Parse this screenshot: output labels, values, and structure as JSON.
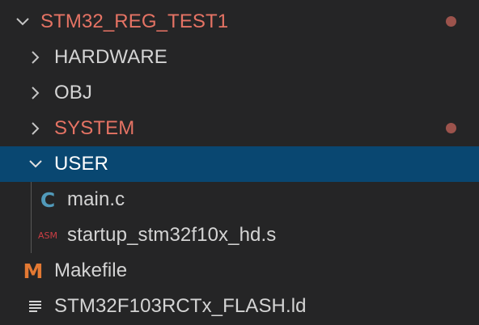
{
  "explorer": {
    "root": {
      "name": "STM32_REG_TEST1",
      "expanded": true,
      "modified": true
    },
    "items": [
      {
        "label": "HARDWARE",
        "type": "folder",
        "expanded": false,
        "modified": false
      },
      {
        "label": "OBJ",
        "type": "folder",
        "expanded": false,
        "modified": false
      },
      {
        "label": "SYSTEM",
        "type": "folder",
        "expanded": false,
        "modified": true
      },
      {
        "label": "USER",
        "type": "folder",
        "expanded": true,
        "selected": true,
        "modified": false
      },
      {
        "label": "main.c",
        "type": "file",
        "icon": "c-file-icon",
        "icon_text": "C"
      },
      {
        "label": "startup_stm32f10x_hd.s",
        "type": "file",
        "icon": "asm-file-icon",
        "icon_text": "ASM"
      },
      {
        "label": "Makefile",
        "type": "file",
        "icon": "makefile-icon",
        "icon_text": "M"
      },
      {
        "label": "STM32F103RCTx_FLASH.ld",
        "type": "file",
        "icon": "text-file-icon"
      }
    ]
  },
  "colors": {
    "background": "#252526",
    "selected_row": "#094771",
    "modified_text": "#e57364",
    "modified_dot": "#9c534c",
    "text": "#d4d4d4",
    "c_icon": "#519aba",
    "asm_icon": "#cc3e44",
    "makefile_icon": "#e37933"
  }
}
